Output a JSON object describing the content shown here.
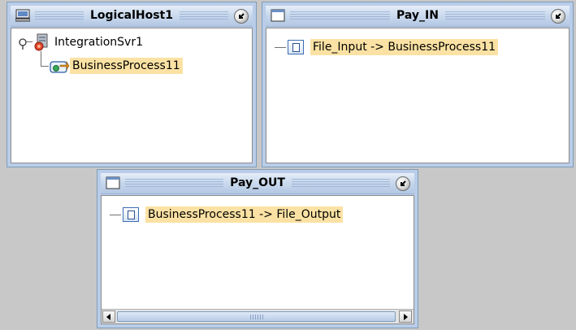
{
  "windows": {
    "logical_host": {
      "title": "LogicalHost1",
      "tree": {
        "server": "IntegrationSvr1",
        "process": "BusinessProcess11"
      }
    },
    "pay_in": {
      "title": "Pay_IN",
      "items": [
        "File_Input -> BusinessProcess11"
      ]
    },
    "pay_out": {
      "title": "Pay_OUT",
      "items": [
        "BusinessProcess11 -> File_Output"
      ]
    }
  },
  "icons": {
    "logical_host": "computer-icon",
    "window": "window-icon",
    "restore": "restore-arrow-icon",
    "server": "integration-server-icon",
    "process": "business-process-icon",
    "connection": "connection-document-icon",
    "expand": "tree-expand-handle-icon"
  },
  "colors": {
    "selection": "#fbe2a4",
    "titlebar": "#b9cde9",
    "background": "#c8c8c8"
  }
}
